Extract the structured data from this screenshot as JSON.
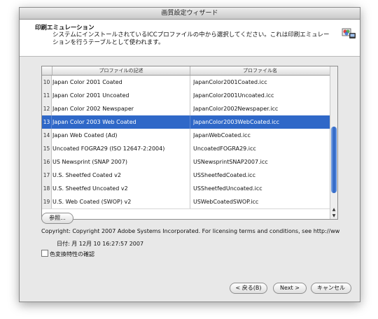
{
  "window": {
    "title": "画質設定ウィザード"
  },
  "header": {
    "title": "印刷エミュレーション",
    "description": "システムにインストールされているICCプロファイルの中から選択してください。これは印刷エミュレーションを行うテーブルとして使われます。",
    "icon": "color-wizard-icon"
  },
  "table": {
    "columns": [
      "プロファイルの記述",
      "プロファイル名"
    ],
    "rows": [
      {
        "num": "10",
        "desc": "Japan Color 2001 Coated",
        "file": "JapanColor2001Coated.icc"
      },
      {
        "num": "11",
        "desc": "Japan Color 2001 Uncoated",
        "file": "JapanColor2001Uncoated.icc"
      },
      {
        "num": "12",
        "desc": "Japan Color 2002 Newspaper",
        "file": "JapanColor2002Newspaper.icc"
      },
      {
        "num": "13",
        "desc": "Japan Color 2003 Web Coated",
        "file": "JapanColor2003WebCoated.icc"
      },
      {
        "num": "14",
        "desc": "Japan Web Coated (Ad)",
        "file": "JapanWebCoated.icc"
      },
      {
        "num": "15",
        "desc": "Uncoated FOGRA29 (ISO 12647-2:2004)",
        "file": "UncoatedFOGRA29.icc"
      },
      {
        "num": "16",
        "desc": "US Newsprint (SNAP 2007)",
        "file": "USNewsprintSNAP2007.icc"
      },
      {
        "num": "17",
        "desc": "U.S. Sheetfed Coated v2",
        "file": "USSheetfedCoated.icc"
      },
      {
        "num": "18",
        "desc": "U.S. Sheetfed Uncoated v2",
        "file": "USSheetfedUncoated.icc"
      },
      {
        "num": "19",
        "desc": "U.S. Web Coated (SWOP) v2",
        "file": "USWebCoatedSWOP.icc"
      }
    ],
    "selected_index": 3
  },
  "browse_label": "参照...",
  "copyright": "Copyright:  Copyright 2007 Adobe Systems Incorporated. For licensing terms and conditions, see http://ww",
  "date": "日付: 月 12月 10 16:27:57 2007",
  "checkbox_label": "色変換特性の確認",
  "buttons": {
    "back": "< 戻る(B)",
    "next": "Next >",
    "cancel": "キャンセル"
  },
  "colors": {
    "selection": "#2f68c8"
  }
}
